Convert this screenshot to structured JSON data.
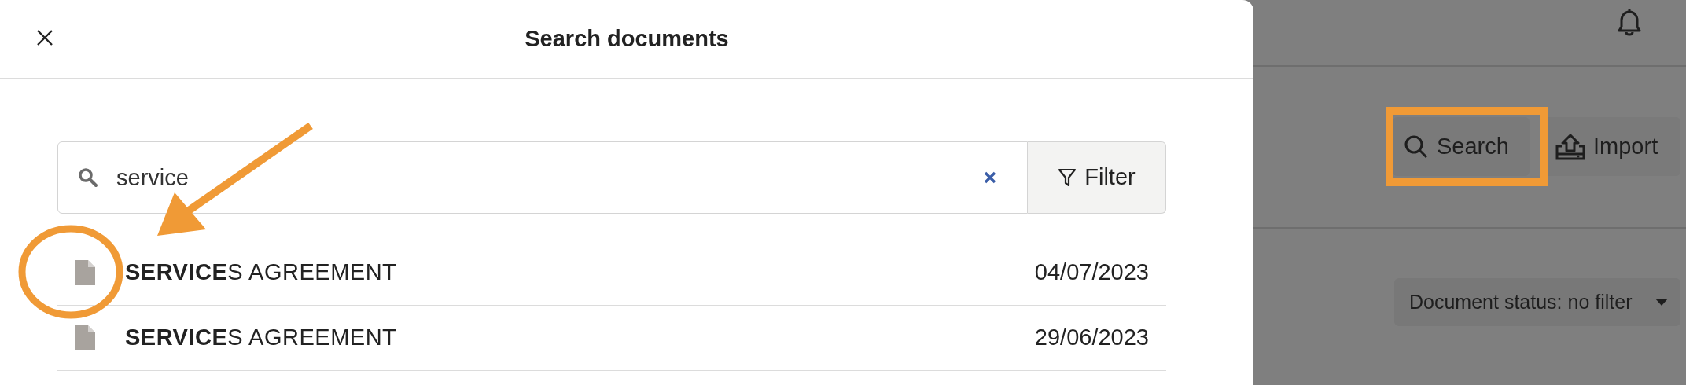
{
  "dialog": {
    "title": "Search documents",
    "search": {
      "value": "service"
    },
    "filter_button": "Filter",
    "results": [
      {
        "name": "**SERVICE**S AGREEMENT",
        "date": "04/07/2023"
      },
      {
        "name": "**SERVICE**S AGREEMENT",
        "date": "29/06/2023"
      }
    ]
  },
  "background": {
    "buttons": [
      {
        "kind": "search",
        "label": "Search"
      },
      {
        "kind": "import",
        "label": "Import"
      }
    ],
    "status_dropdown": "Document status: no filter"
  }
}
